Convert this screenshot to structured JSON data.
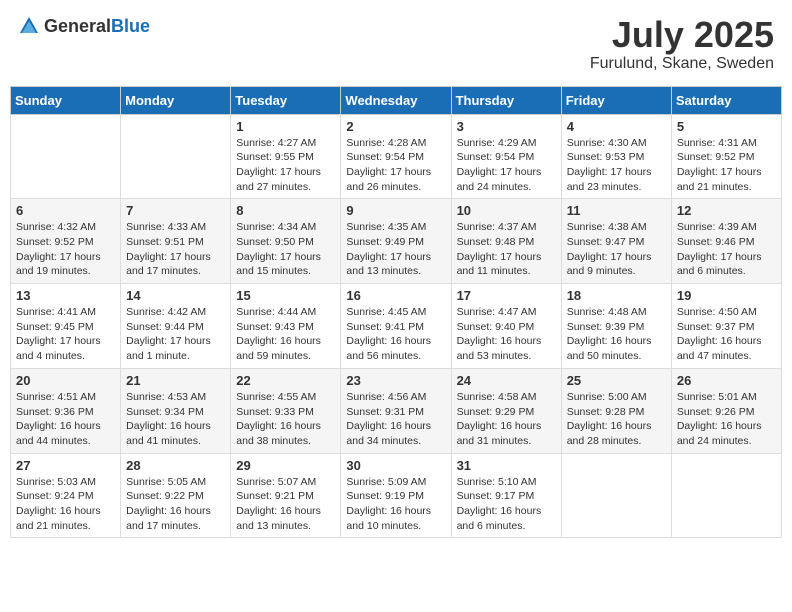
{
  "header": {
    "logo_general": "General",
    "logo_blue": "Blue",
    "month": "July 2025",
    "location": "Furulund, Skane, Sweden"
  },
  "days_of_week": [
    "Sunday",
    "Monday",
    "Tuesday",
    "Wednesday",
    "Thursday",
    "Friday",
    "Saturday"
  ],
  "weeks": [
    [
      {
        "day": "",
        "sunrise": "",
        "sunset": "",
        "daylight": ""
      },
      {
        "day": "",
        "sunrise": "",
        "sunset": "",
        "daylight": ""
      },
      {
        "day": "1",
        "sunrise": "Sunrise: 4:27 AM",
        "sunset": "Sunset: 9:55 PM",
        "daylight": "Daylight: 17 hours and 27 minutes."
      },
      {
        "day": "2",
        "sunrise": "Sunrise: 4:28 AM",
        "sunset": "Sunset: 9:54 PM",
        "daylight": "Daylight: 17 hours and 26 minutes."
      },
      {
        "day": "3",
        "sunrise": "Sunrise: 4:29 AM",
        "sunset": "Sunset: 9:54 PM",
        "daylight": "Daylight: 17 hours and 24 minutes."
      },
      {
        "day": "4",
        "sunrise": "Sunrise: 4:30 AM",
        "sunset": "Sunset: 9:53 PM",
        "daylight": "Daylight: 17 hours and 23 minutes."
      },
      {
        "day": "5",
        "sunrise": "Sunrise: 4:31 AM",
        "sunset": "Sunset: 9:52 PM",
        "daylight": "Daylight: 17 hours and 21 minutes."
      }
    ],
    [
      {
        "day": "6",
        "sunrise": "Sunrise: 4:32 AM",
        "sunset": "Sunset: 9:52 PM",
        "daylight": "Daylight: 17 hours and 19 minutes."
      },
      {
        "day": "7",
        "sunrise": "Sunrise: 4:33 AM",
        "sunset": "Sunset: 9:51 PM",
        "daylight": "Daylight: 17 hours and 17 minutes."
      },
      {
        "day": "8",
        "sunrise": "Sunrise: 4:34 AM",
        "sunset": "Sunset: 9:50 PM",
        "daylight": "Daylight: 17 hours and 15 minutes."
      },
      {
        "day": "9",
        "sunrise": "Sunrise: 4:35 AM",
        "sunset": "Sunset: 9:49 PM",
        "daylight": "Daylight: 17 hours and 13 minutes."
      },
      {
        "day": "10",
        "sunrise": "Sunrise: 4:37 AM",
        "sunset": "Sunset: 9:48 PM",
        "daylight": "Daylight: 17 hours and 11 minutes."
      },
      {
        "day": "11",
        "sunrise": "Sunrise: 4:38 AM",
        "sunset": "Sunset: 9:47 PM",
        "daylight": "Daylight: 17 hours and 9 minutes."
      },
      {
        "day": "12",
        "sunrise": "Sunrise: 4:39 AM",
        "sunset": "Sunset: 9:46 PM",
        "daylight": "Daylight: 17 hours and 6 minutes."
      }
    ],
    [
      {
        "day": "13",
        "sunrise": "Sunrise: 4:41 AM",
        "sunset": "Sunset: 9:45 PM",
        "daylight": "Daylight: 17 hours and 4 minutes."
      },
      {
        "day": "14",
        "sunrise": "Sunrise: 4:42 AM",
        "sunset": "Sunset: 9:44 PM",
        "daylight": "Daylight: 17 hours and 1 minute."
      },
      {
        "day": "15",
        "sunrise": "Sunrise: 4:44 AM",
        "sunset": "Sunset: 9:43 PM",
        "daylight": "Daylight: 16 hours and 59 minutes."
      },
      {
        "day": "16",
        "sunrise": "Sunrise: 4:45 AM",
        "sunset": "Sunset: 9:41 PM",
        "daylight": "Daylight: 16 hours and 56 minutes."
      },
      {
        "day": "17",
        "sunrise": "Sunrise: 4:47 AM",
        "sunset": "Sunset: 9:40 PM",
        "daylight": "Daylight: 16 hours and 53 minutes."
      },
      {
        "day": "18",
        "sunrise": "Sunrise: 4:48 AM",
        "sunset": "Sunset: 9:39 PM",
        "daylight": "Daylight: 16 hours and 50 minutes."
      },
      {
        "day": "19",
        "sunrise": "Sunrise: 4:50 AM",
        "sunset": "Sunset: 9:37 PM",
        "daylight": "Daylight: 16 hours and 47 minutes."
      }
    ],
    [
      {
        "day": "20",
        "sunrise": "Sunrise: 4:51 AM",
        "sunset": "Sunset: 9:36 PM",
        "daylight": "Daylight: 16 hours and 44 minutes."
      },
      {
        "day": "21",
        "sunrise": "Sunrise: 4:53 AM",
        "sunset": "Sunset: 9:34 PM",
        "daylight": "Daylight: 16 hours and 41 minutes."
      },
      {
        "day": "22",
        "sunrise": "Sunrise: 4:55 AM",
        "sunset": "Sunset: 9:33 PM",
        "daylight": "Daylight: 16 hours and 38 minutes."
      },
      {
        "day": "23",
        "sunrise": "Sunrise: 4:56 AM",
        "sunset": "Sunset: 9:31 PM",
        "daylight": "Daylight: 16 hours and 34 minutes."
      },
      {
        "day": "24",
        "sunrise": "Sunrise: 4:58 AM",
        "sunset": "Sunset: 9:29 PM",
        "daylight": "Daylight: 16 hours and 31 minutes."
      },
      {
        "day": "25",
        "sunrise": "Sunrise: 5:00 AM",
        "sunset": "Sunset: 9:28 PM",
        "daylight": "Daylight: 16 hours and 28 minutes."
      },
      {
        "day": "26",
        "sunrise": "Sunrise: 5:01 AM",
        "sunset": "Sunset: 9:26 PM",
        "daylight": "Daylight: 16 hours and 24 minutes."
      }
    ],
    [
      {
        "day": "27",
        "sunrise": "Sunrise: 5:03 AM",
        "sunset": "Sunset: 9:24 PM",
        "daylight": "Daylight: 16 hours and 21 minutes."
      },
      {
        "day": "28",
        "sunrise": "Sunrise: 5:05 AM",
        "sunset": "Sunset: 9:22 PM",
        "daylight": "Daylight: 16 hours and 17 minutes."
      },
      {
        "day": "29",
        "sunrise": "Sunrise: 5:07 AM",
        "sunset": "Sunset: 9:21 PM",
        "daylight": "Daylight: 16 hours and 13 minutes."
      },
      {
        "day": "30",
        "sunrise": "Sunrise: 5:09 AM",
        "sunset": "Sunset: 9:19 PM",
        "daylight": "Daylight: 16 hours and 10 minutes."
      },
      {
        "day": "31",
        "sunrise": "Sunrise: 5:10 AM",
        "sunset": "Sunset: 9:17 PM",
        "daylight": "Daylight: 16 hours and 6 minutes."
      },
      {
        "day": "",
        "sunrise": "",
        "sunset": "",
        "daylight": ""
      },
      {
        "day": "",
        "sunrise": "",
        "sunset": "",
        "daylight": ""
      }
    ]
  ]
}
